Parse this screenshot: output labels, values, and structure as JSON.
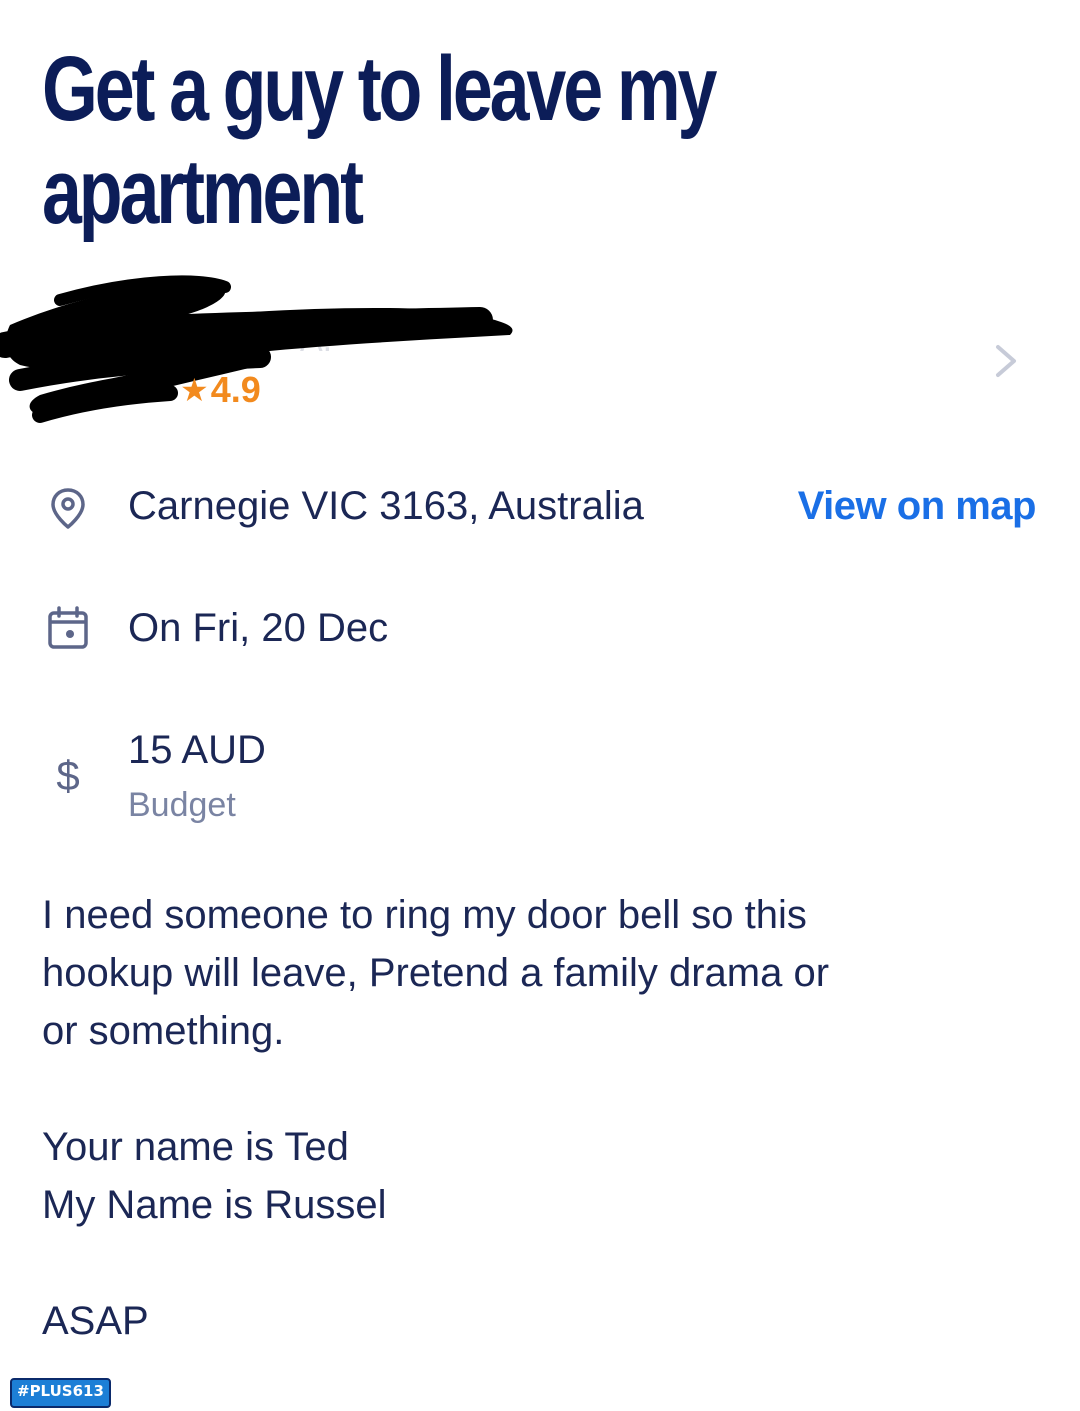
{
  "task": {
    "title": "Get a guy to leave my apartment"
  },
  "poster": {
    "name": "A.",
    "rating": "4.9",
    "rating_icon": "star-icon",
    "redacted": true
  },
  "details": {
    "location": {
      "icon": "location-pin-icon",
      "text": "Carnegie VIC 3163, Australia",
      "link": "View on map"
    },
    "date": {
      "icon": "calendar-icon",
      "text": "On Fri, 20 Dec"
    },
    "budget": {
      "icon": "dollar-icon",
      "amount": "15 AUD",
      "label": "Budget"
    }
  },
  "description": "I need someone to ring my door bell so this\nhookup will leave, Pretend a family drama or\nor something.\n\nYour name is Ted\nMy Name is Russel\n\nASAP",
  "watermark": "#PLUS613",
  "colors": {
    "title": "#0c1d58",
    "text": "#1b2755",
    "link": "#1a6fe6",
    "rating": "#f28a1e",
    "muted": "#7a84a3",
    "icon": "#5d6689"
  }
}
